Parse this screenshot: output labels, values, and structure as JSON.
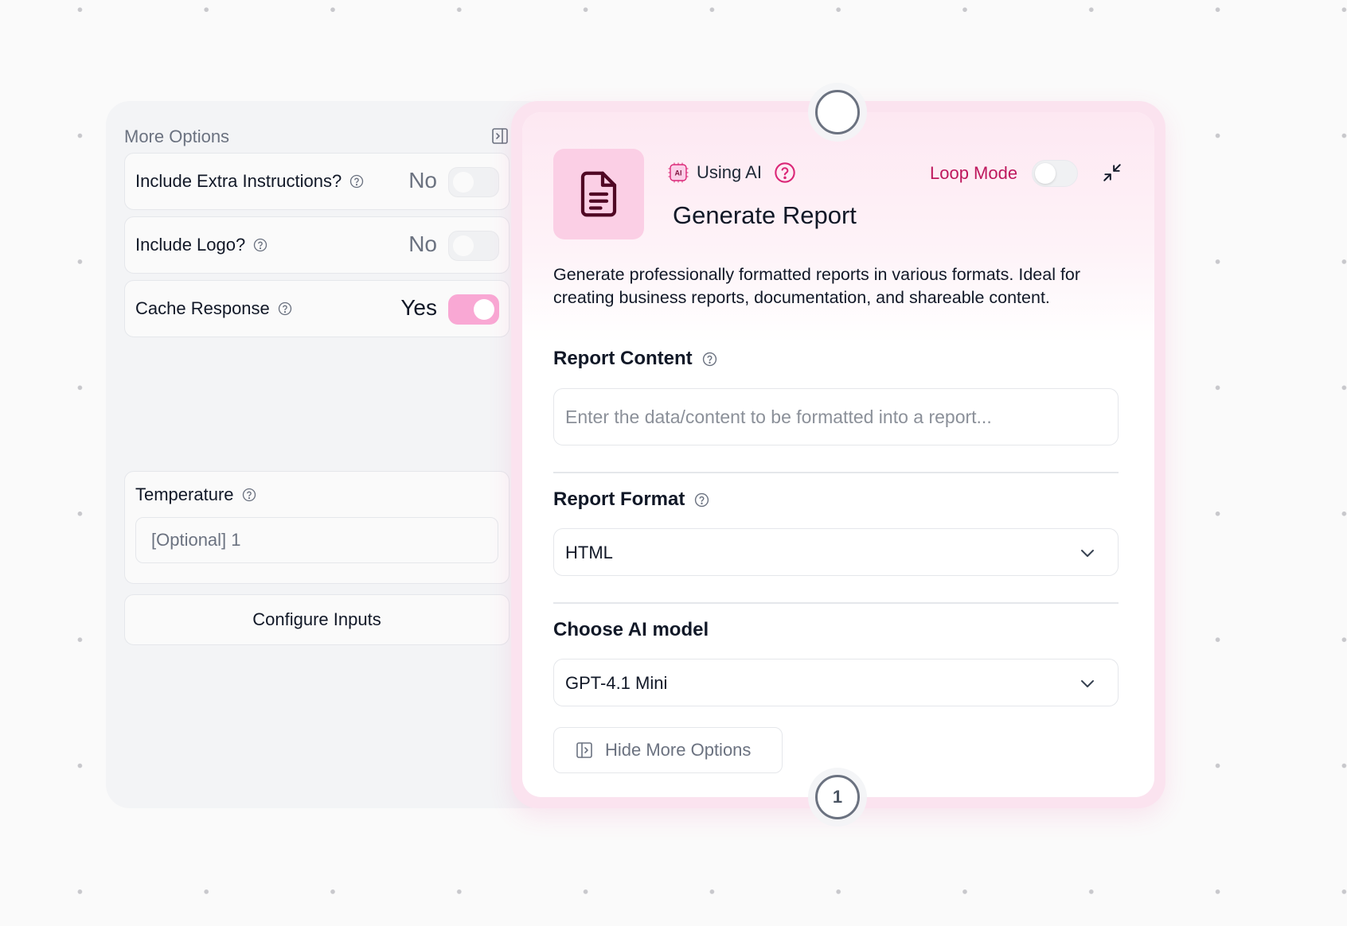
{
  "options_panel": {
    "title": "More Options",
    "rows": [
      {
        "label": "Include Extra Instructions?",
        "value": "No",
        "enabled": false
      },
      {
        "label": "Include Logo?",
        "value": "No",
        "enabled": false
      },
      {
        "label": "Cache Response",
        "value": "Yes",
        "enabled": true
      }
    ],
    "temperature": {
      "label": "Temperature",
      "placeholder": "[Optional] 1"
    },
    "configure_button": "Configure Inputs"
  },
  "node": {
    "using_ai_label": "Using AI",
    "ai_badge_text": "AI",
    "loop_mode_label": "Loop Mode",
    "loop_mode_enabled": false,
    "title": "Generate Report",
    "description": "Generate professionally formatted reports in various formats. Ideal for creating business reports, documentation, and shareable content.",
    "fields": {
      "report_content": {
        "label": "Report Content",
        "placeholder": "Enter the data/content to be formatted into a report..."
      },
      "report_format": {
        "label": "Report Format",
        "value": "HTML"
      },
      "ai_model": {
        "label": "Choose AI model",
        "value": "GPT-4.1 Mini"
      }
    },
    "hide_options_button": "Hide More Options",
    "output_handle_label": "1"
  },
  "colors": {
    "accent_pink": "#f9a8d4",
    "loop_mode_text": "#be185d",
    "help_icon_pink": "#db2777",
    "node_border": "#fbe3ef"
  }
}
